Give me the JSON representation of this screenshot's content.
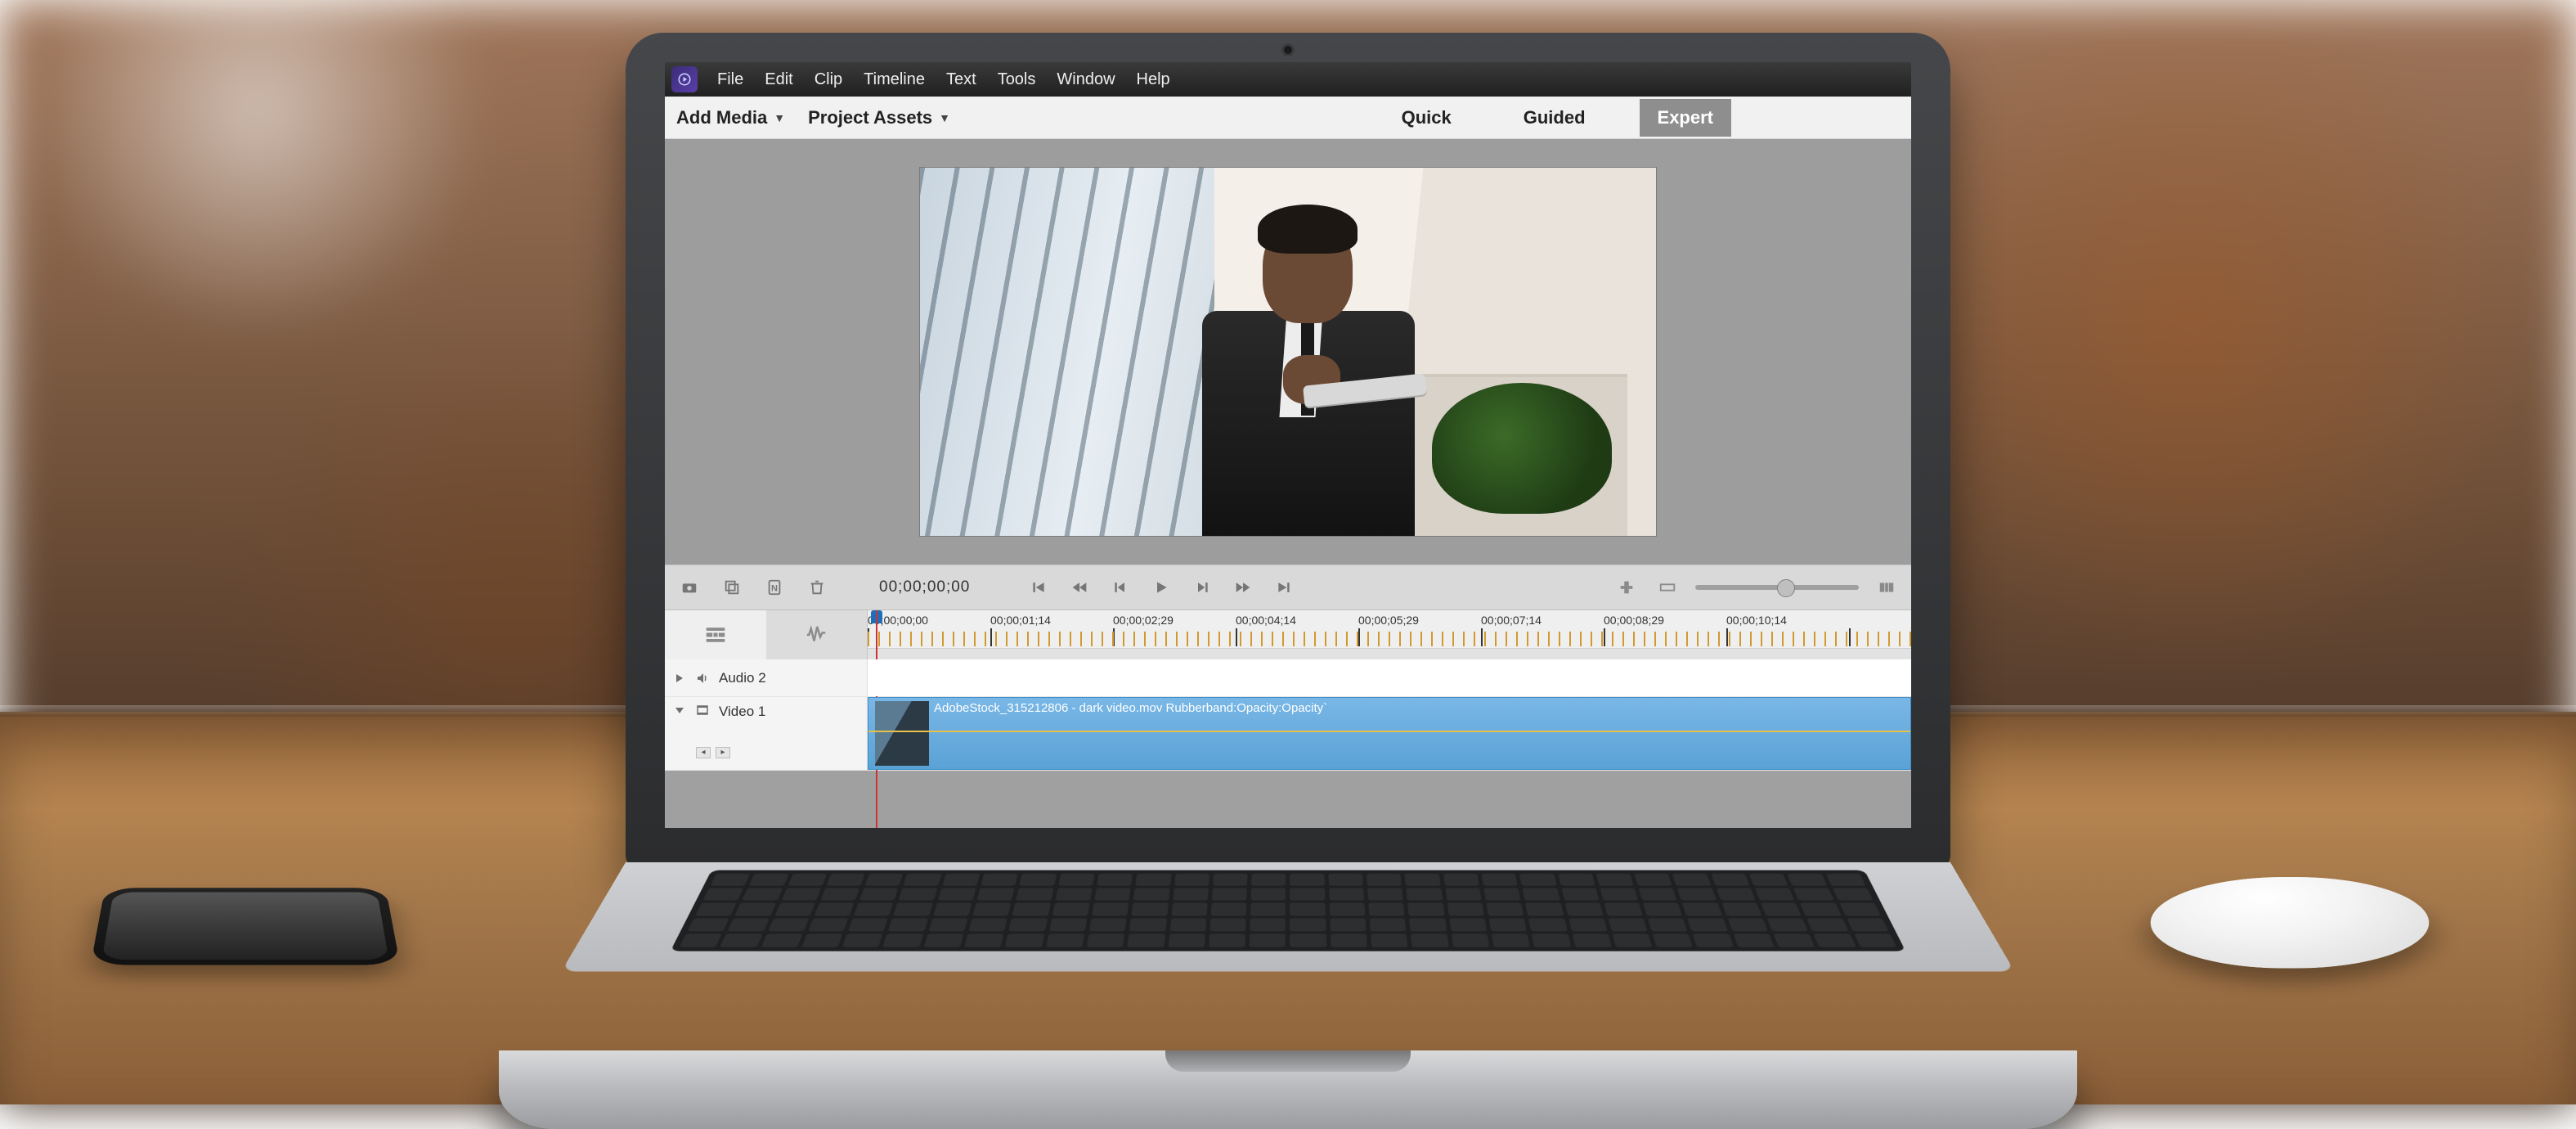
{
  "menu": {
    "items": [
      "File",
      "Edit",
      "Clip",
      "Timeline",
      "Text",
      "Tools",
      "Window",
      "Help"
    ]
  },
  "toolbar": {
    "add_media": "Add Media",
    "project_assets": "Project Assets",
    "modes": {
      "quick": "Quick",
      "guided": "Guided",
      "expert": "Expert"
    },
    "active_mode": "expert"
  },
  "transport": {
    "timecode": "00;00;00;00"
  },
  "ruler": {
    "labels": [
      "00;00;00;00",
      "00;00;01;14",
      "00;00;02;29",
      "00;00;04;14",
      "00;00;05;29",
      "00;00;07;14",
      "00;00;08;29",
      "00;00;10;14"
    ]
  },
  "tracks": {
    "audio2": {
      "name": "Audio 2"
    },
    "video1": {
      "name": "Video 1",
      "clip_label": "AdobeStock_315212806 - dark video.mov Rubberband:Opacity:Opacity`"
    }
  }
}
